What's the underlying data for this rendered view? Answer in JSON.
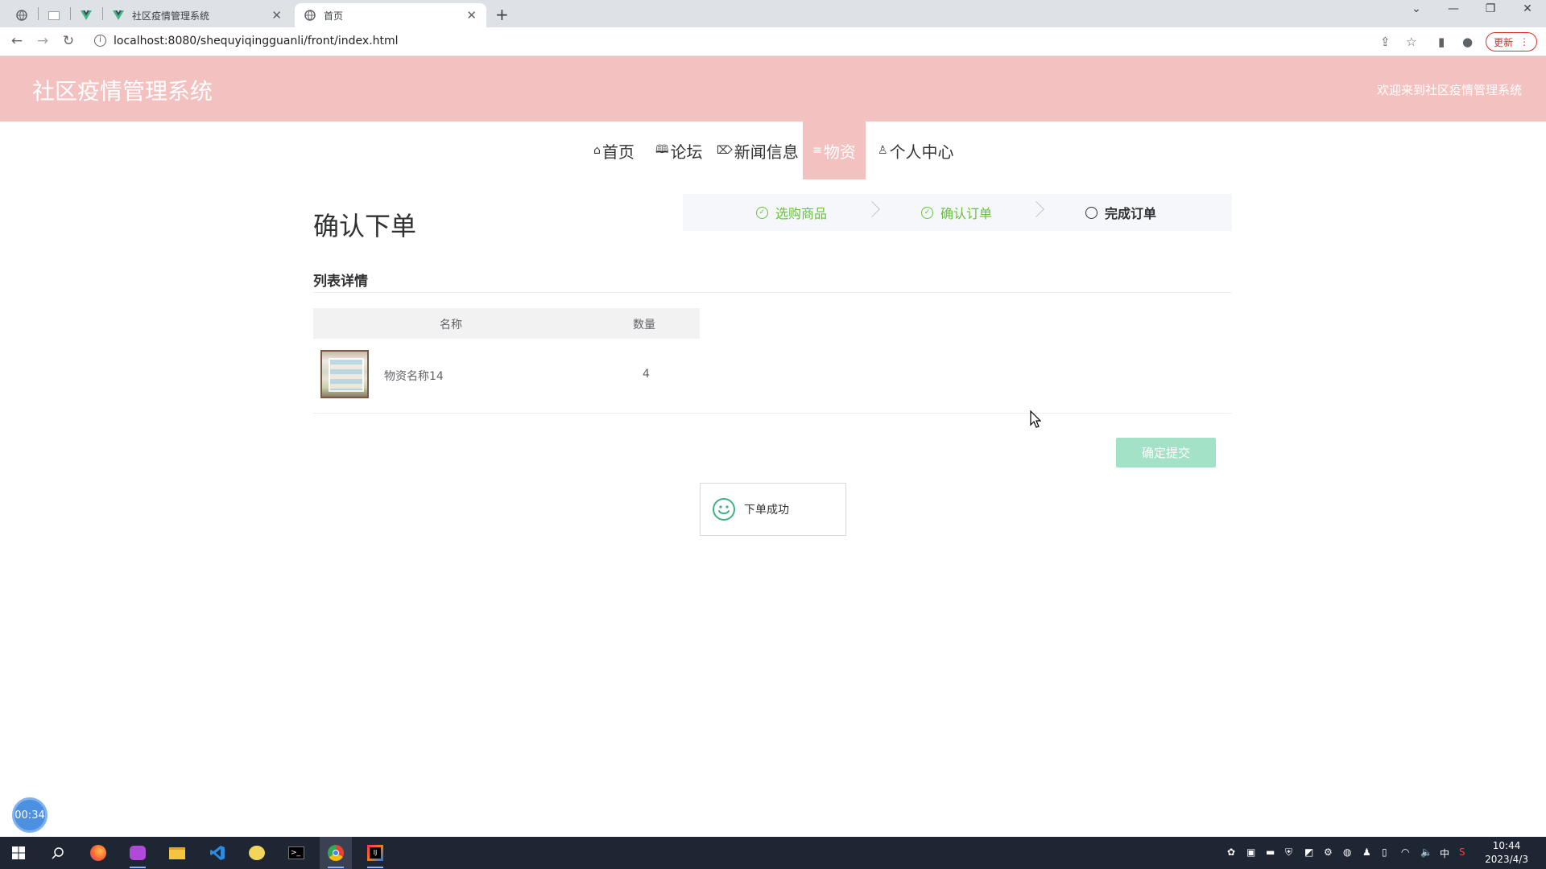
{
  "browser": {
    "tabs": [
      {
        "title": "社区疫情管理系统",
        "favicon": "vue-icon"
      },
      {
        "title": "首页",
        "favicon": "globe-icon",
        "active": true
      }
    ],
    "url": "localhost:8080/shequyiqingguanli/front/index.html",
    "update_label": "更新"
  },
  "header": {
    "site_title": "社区疫情管理系统",
    "welcome": "欢迎来到社区疫情管理系统",
    "bg_color": "#f4c1c1"
  },
  "nav": {
    "items": [
      {
        "label": "首页",
        "icon": "home-icon"
      },
      {
        "label": "论坛",
        "icon": "book-icon"
      },
      {
        "label": "新闻信息",
        "icon": "tag-icon"
      },
      {
        "label": "物资",
        "icon": "list-icon",
        "active": true
      },
      {
        "label": "个人中心",
        "icon": "user-icon"
      }
    ]
  },
  "main": {
    "page_title": "确认下单",
    "steps": [
      {
        "label": "选购商品",
        "status": "done"
      },
      {
        "label": "确认订单",
        "status": "done"
      },
      {
        "label": "完成订单",
        "status": "current"
      }
    ],
    "section_title": "列表详情",
    "table": {
      "columns": [
        "名称",
        "数量"
      ],
      "rows": [
        {
          "name": "物资名称14",
          "quantity": "4"
        }
      ]
    },
    "submit_label": "确定提交",
    "toast_message": "下单成功"
  },
  "timer": "00:34",
  "taskbar": {
    "time": "10:44",
    "date": "2023/4/3",
    "ime": "中"
  }
}
